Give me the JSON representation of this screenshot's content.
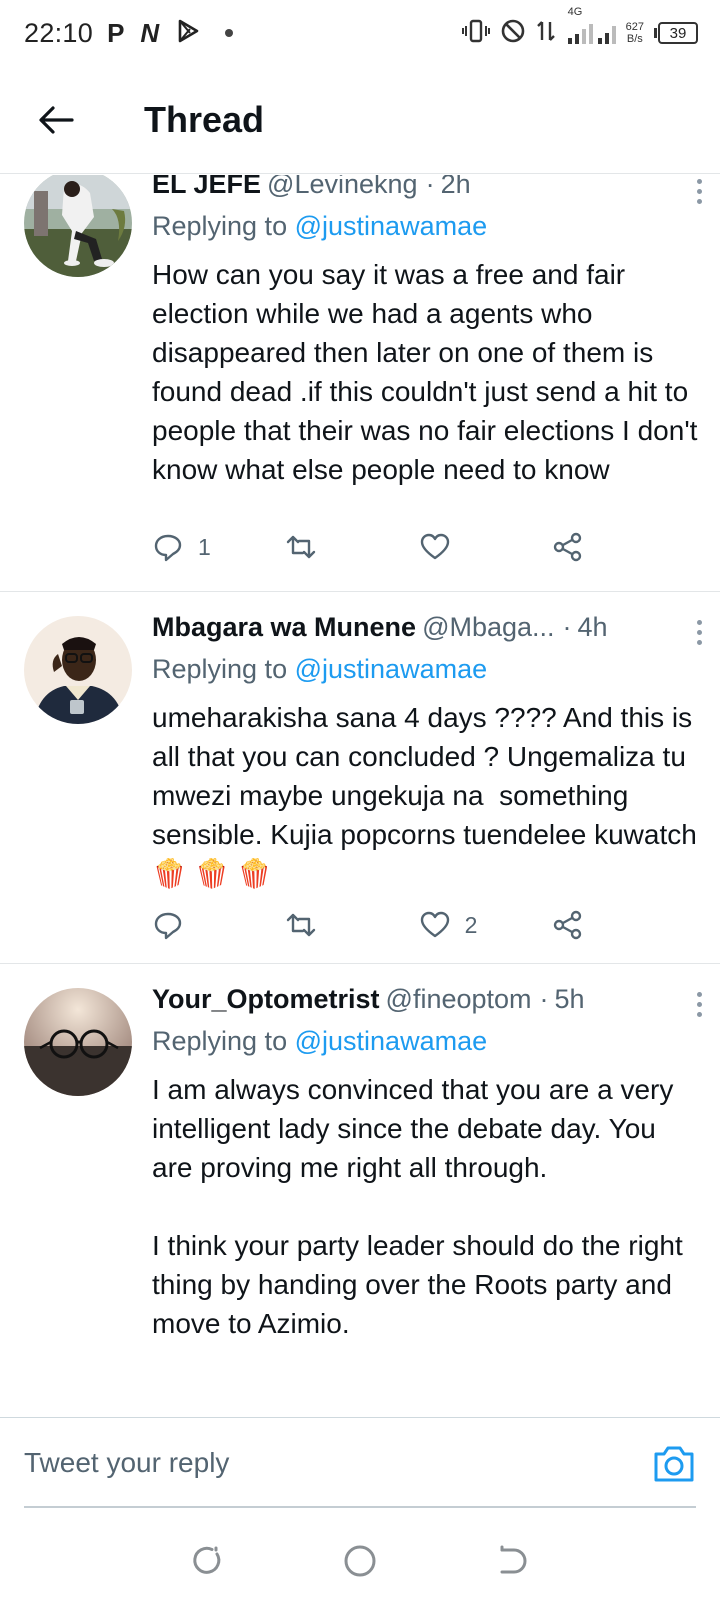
{
  "status_bar": {
    "time": "22:10",
    "left_icons": [
      "P",
      "N",
      "play-icon"
    ],
    "net_speed_value": "627",
    "net_speed_unit": "B/s",
    "network": "4G",
    "battery": "39"
  },
  "header": {
    "title": "Thread"
  },
  "tweets": [
    {
      "display_name": "EL JEFE",
      "handle": "@Levinekng",
      "sep": "·",
      "time": "2h",
      "replying_prefix": "Replying to",
      "replying_to": "@justinawamae",
      "text": "How can you say it was a free and fair election while we had a agents who disappeared then later on one of them is found dead .if this couldn't just send a hit to people that their was no fair elections I don't know what else people need to know",
      "reply_count": "1",
      "retweet_count": "",
      "like_count": ""
    },
    {
      "display_name": "Mbagara wa Munene",
      "handle": "@Mbaga...",
      "sep": "·",
      "time": "4h",
      "replying_prefix": "Replying to",
      "replying_to": "@justinawamae",
      "text": "umeharakisha sana 4 days ???? And this is all that you can concluded ? Ungemaliza tu mwezi maybe ungekuja na  something sensible. Kujia popcorns tuendelee kuwatch 🍿 🍿 🍿",
      "reply_count": "",
      "retweet_count": "",
      "like_count": "2"
    },
    {
      "display_name": "Your_Optometrist",
      "handle": "@fineoptom",
      "sep": "·",
      "time": "5h",
      "replying_prefix": "Replying to",
      "replying_to": "@justinawamae",
      "text": "I am always convinced that you are a very intelligent lady since the debate day. You are proving me right all through.\n\nI think your party leader should do the right thing by handing over the Roots party and move to Azimio.",
      "reply_count": "",
      "retweet_count": "",
      "like_count": ""
    }
  ],
  "composer": {
    "placeholder": "Tweet your reply"
  },
  "colors": {
    "accent": "#1d9bf0",
    "secondary_text": "#536471",
    "divider": "#e3e6e8"
  }
}
